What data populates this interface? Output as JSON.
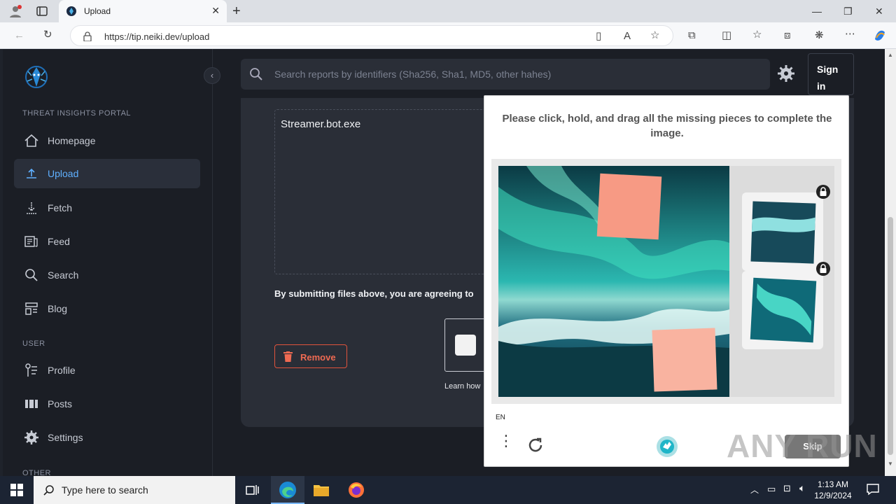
{
  "browser": {
    "tab_title": "Upload",
    "url": "https://tip.neiki.dev/upload"
  },
  "sidebar": {
    "section_portal": "THREAT INSIGHTS PORTAL",
    "items": [
      {
        "label": "Homepage",
        "icon": "home-icon"
      },
      {
        "label": "Upload",
        "icon": "upload-icon"
      },
      {
        "label": "Fetch",
        "icon": "fetch-icon"
      },
      {
        "label": "Feed",
        "icon": "feed-icon"
      },
      {
        "label": "Search",
        "icon": "search-icon"
      },
      {
        "label": "Blog",
        "icon": "blog-icon"
      }
    ],
    "section_user": "USER",
    "user_items": [
      {
        "label": "Profile",
        "icon": "profile-icon"
      },
      {
        "label": "Posts",
        "icon": "posts-icon"
      },
      {
        "label": "Settings",
        "icon": "settings-icon"
      }
    ],
    "section_other": "OTHER"
  },
  "header": {
    "search_placeholder": "Search reports by identifiers (Sha256, Sha1, MD5, other hahes)",
    "signin_label": "Sign in"
  },
  "upload": {
    "filename": "Streamer.bot.exe",
    "agree_text": "By submitting files above, you are agreeing to",
    "remove_label": "Remove",
    "learn_text": "Learn how"
  },
  "captcha": {
    "prompt": "Please click, hold, and drag all the missing pieces to complete the image.",
    "language": "EN",
    "skip_label": "Skip"
  },
  "watermark": "ANY RUN",
  "taskbar": {
    "search_placeholder": "Type here to search",
    "time": "1:13 AM",
    "date": "12/9/2024"
  },
  "colors": {
    "accent": "#5fb0ff",
    "danger": "#ef6a52",
    "background": "#1b1e25",
    "card": "#2a2e37"
  }
}
